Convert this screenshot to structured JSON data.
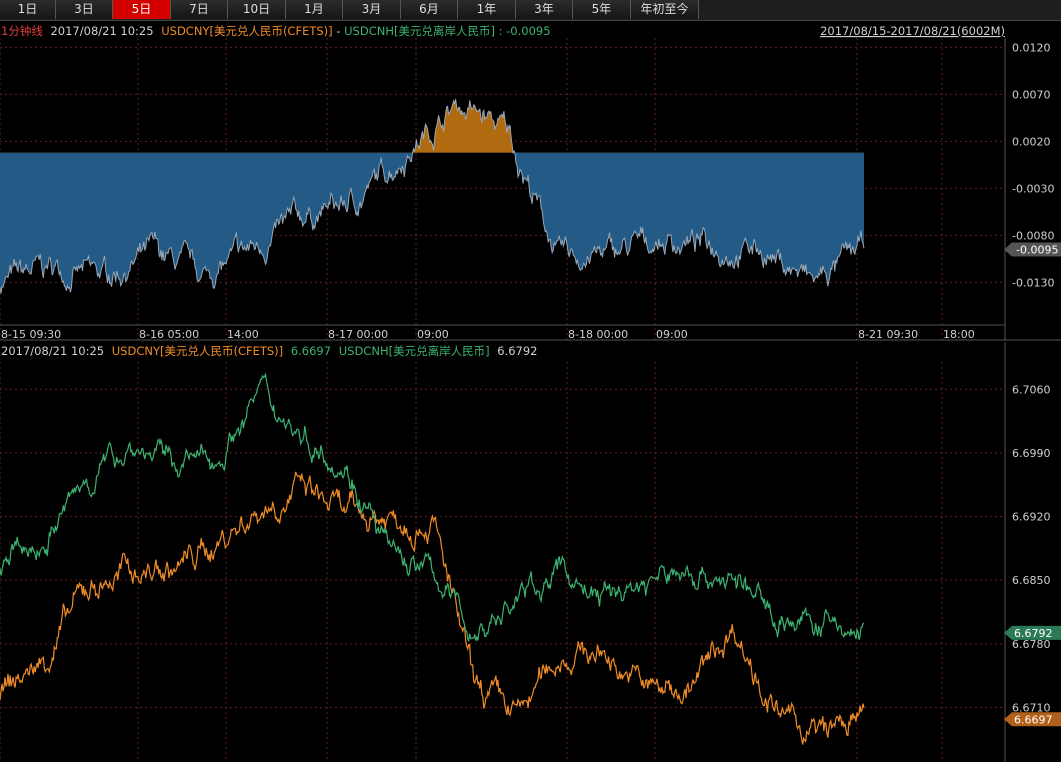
{
  "tabs": [
    {
      "label": "1日",
      "active": false,
      "w": 56
    },
    {
      "label": "3日",
      "active": false,
      "w": 57
    },
    {
      "label": "5日",
      "active": true,
      "w": 58
    },
    {
      "label": "7日",
      "active": false,
      "w": 57
    },
    {
      "label": "10日",
      "active": false,
      "w": 58
    },
    {
      "label": "1月",
      "active": false,
      "w": 57
    },
    {
      "label": "3月",
      "active": false,
      "w": 58
    },
    {
      "label": "6月",
      "active": false,
      "w": 57
    },
    {
      "label": "1年",
      "active": false,
      "w": 58
    },
    {
      "label": "3年",
      "active": false,
      "w": 57
    },
    {
      "label": "5年",
      "active": false,
      "w": 58
    },
    {
      "label": "年初至今",
      "active": false,
      "w": 68
    }
  ],
  "top_header": {
    "interval": "1分钟线",
    "datetime": "2017/08/21 10:25",
    "series1": "USDCNY[美元兑人民币(CFETS)]",
    "dash": " - ",
    "series2": "USDCNH[美元兑离岸人民币]",
    "colon": " : ",
    "value": "-0.0095",
    "range": "2017/08/15-2017/08/21(6002M)"
  },
  "bottom_header": {
    "datetime": "2017/08/21 10:25",
    "series1": "USDCNY[美元兑人民币(CFETS)]",
    "value1": "6.6697",
    "series2": "USDCNH[美元兑离岸人民币]",
    "value2": "6.6792"
  },
  "colors": {
    "cny": "#f08c28",
    "cnh": "#3cb371",
    "spread_fill": "#235b86",
    "spread_pos_fill": "#b06a10",
    "spread_line": "#9aa8b8",
    "grid": "#6a1c1c",
    "axis": "#555",
    "text": "#cfcfcf",
    "header_red": "#e63c3c",
    "tab_active": "#d40000"
  },
  "chart_data": [
    {
      "type": "area",
      "series": [
        {
          "name": "USDCNY[美元兑人民币(CFETS)] - USDCNH[美元兑离岸人民币]",
          "x": [
            "8-15 09:30",
            "8-15 18:00",
            "8-16 00:00",
            "8-16 05:00",
            "8-16 09:00",
            "8-16 14:00",
            "8-16 20:00",
            "8-17 00:00",
            "8-17 04:00",
            "8-17 07:00",
            "8-17 09:00",
            "8-17 18:00",
            "8-18 00:00",
            "8-18 09:00",
            "8-18 14:00",
            "8-18 20:00",
            "8-21 09:30",
            "8-21 10:25"
          ],
          "values": [
            -0.013,
            -0.0115,
            -0.0125,
            -0.01,
            -0.0125,
            -0.0095,
            -0.006,
            -0.0045,
            0.001,
            0.006,
            0.003,
            -0.0105,
            -0.01,
            -0.0085,
            -0.009,
            -0.0095,
            -0.013,
            -0.0095
          ]
        }
      ],
      "yticks": [
        "0.0120",
        "0.0070",
        "0.0020",
        "-0.0030",
        "-0.0080",
        "-0.0130"
      ],
      "ylim": [
        -0.017,
        0.013
      ],
      "xticks": [
        "8-15 09:30",
        "8-16 05:00",
        "14:00",
        "8-17 00:00",
        "09:00",
        "8-18 00:00",
        "09:00",
        "8-21 09:30",
        "18:00"
      ],
      "current_label": "-0.0095"
    },
    {
      "type": "line",
      "x": [
        "8-15 09:30",
        "8-15 14:00",
        "8-15 20:00",
        "8-16 00:00",
        "8-16 05:00",
        "8-16 09:00",
        "8-16 14:00",
        "8-16 20:00",
        "8-17 00:00",
        "8-17 04:00",
        "8-17 07:00",
        "8-17 09:00",
        "8-17 14:00",
        "8-17 20:00",
        "8-18 00:00",
        "8-18 05:00",
        "8-18 09:00",
        "8-18 14:00",
        "8-18 20:00",
        "8-21 09:30",
        "8-21 10:25"
      ],
      "series": [
        {
          "name": "USDCNY[美元兑人民币(CFETS)]",
          "values": [
            6.6725,
            6.676,
            6.684,
            6.686,
            6.686,
            6.689,
            6.693,
            6.695,
            6.692,
            6.692,
            6.692,
            6.6725,
            6.67,
            6.677,
            6.677,
            6.673,
            6.673,
            6.68,
            6.67,
            6.668,
            6.6697
          ]
        },
        {
          "name": "USDCNH[美元兑离岸人民币]",
          "values": [
            6.687,
            6.689,
            6.696,
            6.7,
            6.698,
            6.698,
            6.706,
            6.701,
            6.698,
            6.688,
            6.686,
            6.679,
            6.683,
            6.686,
            6.683,
            6.685,
            6.686,
            6.685,
            6.681,
            6.68,
            6.6792
          ]
        }
      ],
      "yticks": [
        "6.7060",
        "6.6990",
        "6.6920",
        "6.6850",
        "6.6780",
        "6.6710"
      ],
      "ylim": [
        6.665,
        6.709
      ],
      "labels": [
        {
          "text": "6.6792",
          "series": 1
        },
        {
          "text": "6.6697",
          "series": 0
        }
      ]
    }
  ]
}
